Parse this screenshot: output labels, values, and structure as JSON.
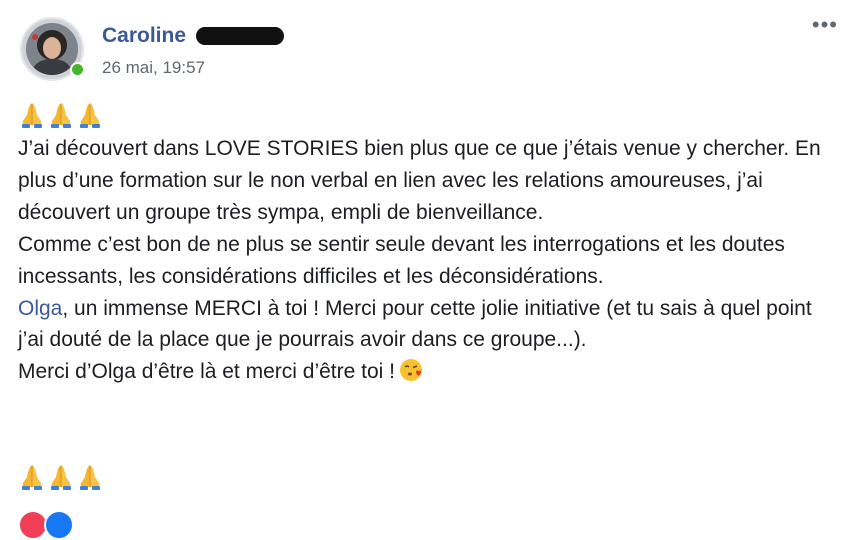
{
  "post": {
    "author": {
      "name": "Caroline",
      "surname_redacted": true
    },
    "timestamp": "26 mai, 19:57",
    "more_menu_icon": "more-horizontal-icon",
    "emoji_top": [
      "folded-hands",
      "folded-hands",
      "folded-hands"
    ],
    "paragraphs": [
      "J’ai découvert dans LOVE STORIES bien plus que ce que j’étais venue y chercher. En plus d’une formation sur le non verbal en lien avec les relations amoureuses, j’ai découvert un groupe très sympa, empli de bienveillance.",
      "Comme c’est bon de ne plus se sentir seule devant les interrogations et les doutes incessants, les considérations difficiles et les déconsidérations."
    ],
    "mention_name": "Olga",
    "mention_tail": ", un immense MERCI à toi ! Merci pour cette jolie initiative (et tu sais à quel point j’ai douté de la place que je pourrais avoir dans ce groupe...).",
    "closing": "Merci d’Olga d’être là et merci d’être toi !",
    "closing_emoji": "face-blowing-a-kiss",
    "emoji_bottom": [
      "folded-hands",
      "folded-hands",
      "folded-hands"
    ],
    "colors": {
      "author": "#3b5998",
      "mention": "#3b5998",
      "online": "#42b72a",
      "meta": "#606770"
    }
  }
}
